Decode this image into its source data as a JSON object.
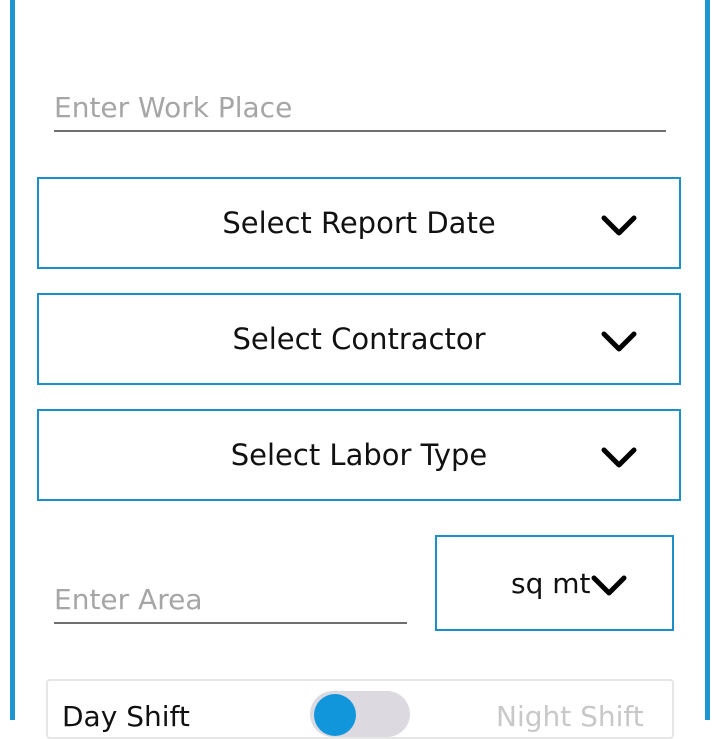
{
  "form": {
    "work_place": {
      "placeholder": "Enter Work Place",
      "value": ""
    },
    "report_date": {
      "label": "Select Report Date"
    },
    "contractor": {
      "label": "Select Contractor"
    },
    "labor_type": {
      "label": "Select Labor Type"
    },
    "area": {
      "placeholder": "Enter Area",
      "value": ""
    },
    "unit": {
      "selected": "sq mt"
    },
    "shift": {
      "day_label": "Day Shift",
      "night_label": "Night Shift",
      "selected": "Day Shift"
    }
  },
  "colors": {
    "accent": "#1e96d2",
    "toggle_knob": "#1196dc",
    "toggle_track": "#dcd9e0",
    "placeholder": "#a6a6a6"
  },
  "icons": {
    "dropdown": "chevron-down-icon"
  }
}
